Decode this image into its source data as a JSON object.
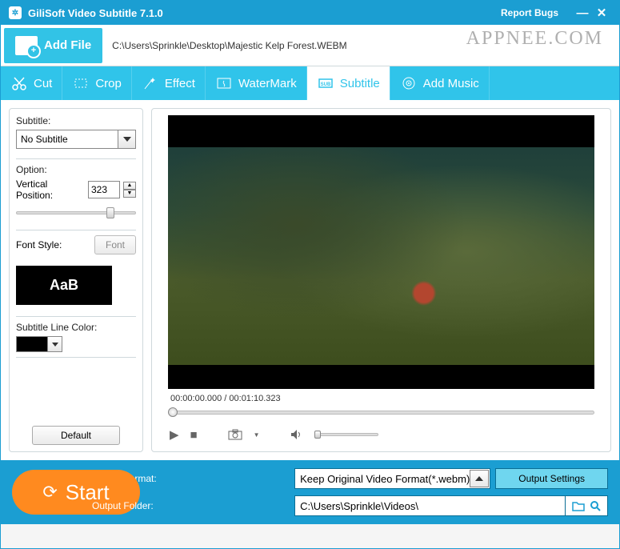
{
  "titlebar": {
    "title": "GiliSoft Video Subtitle 7.1.0",
    "report": "Report Bugs"
  },
  "toolbar": {
    "add_file": "Add File",
    "filepath": "C:\\Users\\Sprinkle\\Desktop\\Majestic Kelp Forest.WEBM",
    "watermark": "APPNEE.COM"
  },
  "tabs": {
    "cut": "Cut",
    "crop": "Crop",
    "effect": "Effect",
    "watermark": "WaterMark",
    "subtitle": "Subtitle",
    "addmusic": "Add Music"
  },
  "side": {
    "subtitle_label": "Subtitle:",
    "subtitle_value": "No Subtitle",
    "option_label": "Option:",
    "vpos_label": "Vertical Position:",
    "vpos_value": "323",
    "font_style_label": "Font Style:",
    "font_btn": "Font",
    "font_preview": "AaB",
    "line_color_label": "Subtitle Line Color:",
    "line_color": "#000000",
    "default_btn": "Default"
  },
  "preview": {
    "timecode": "00:00:00.000 / 00:01:10.323"
  },
  "footer": {
    "format_label": "Output Format:",
    "format_value": "Keep Original Video Format(*.webm)",
    "output_settings": "Output Settings",
    "folder_label": "Output Folder:",
    "folder_value": "C:\\Users\\Sprinkle\\Videos\\",
    "start": "Start"
  }
}
